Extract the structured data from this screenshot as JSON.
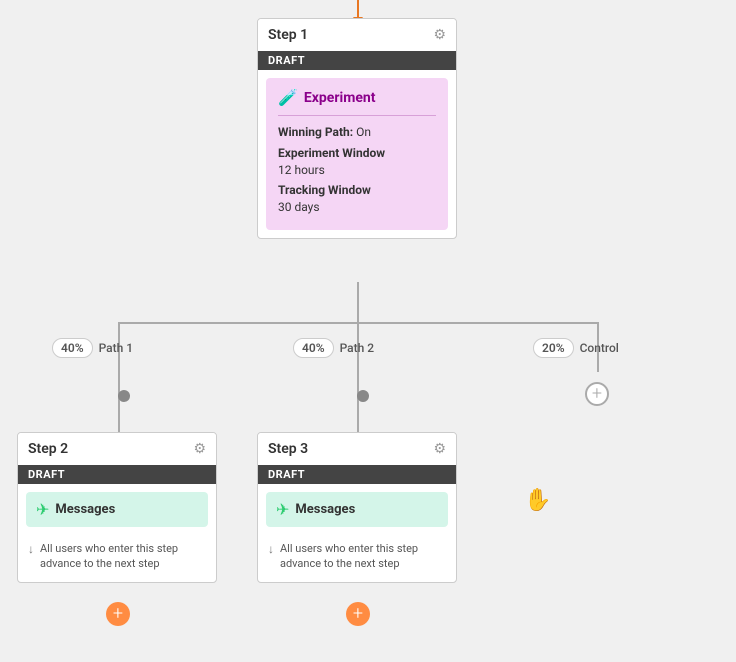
{
  "topArrow": {
    "color": "#e87722"
  },
  "step1": {
    "title": "Step 1",
    "status": "DRAFT",
    "experiment": {
      "label": "Experiment",
      "winningPath": {
        "label": "Winning Path:",
        "value": "On"
      },
      "experimentWindow": {
        "label": "Experiment Window",
        "value": "12 hours"
      },
      "trackingWindow": {
        "label": "Tracking Window",
        "value": "30 days"
      }
    },
    "gearIcon": "⚙"
  },
  "paths": [
    {
      "percent": "40%",
      "name": "Path 1"
    },
    {
      "percent": "40%",
      "name": "Path 2"
    },
    {
      "percent": "20%",
      "name": "Control"
    }
  ],
  "step2": {
    "title": "Step 2",
    "status": "DRAFT",
    "messages": {
      "label": "Messages"
    },
    "info": "All users who enter this step advance to the next step",
    "gearIcon": "⚙"
  },
  "step3": {
    "title": "Step 3",
    "status": "DRAFT",
    "messages": {
      "label": "Messages"
    },
    "info": "All users who enter this step advance to the next step",
    "gearIcon": "⚙"
  },
  "plusButton": "+",
  "handCursor": "☞"
}
